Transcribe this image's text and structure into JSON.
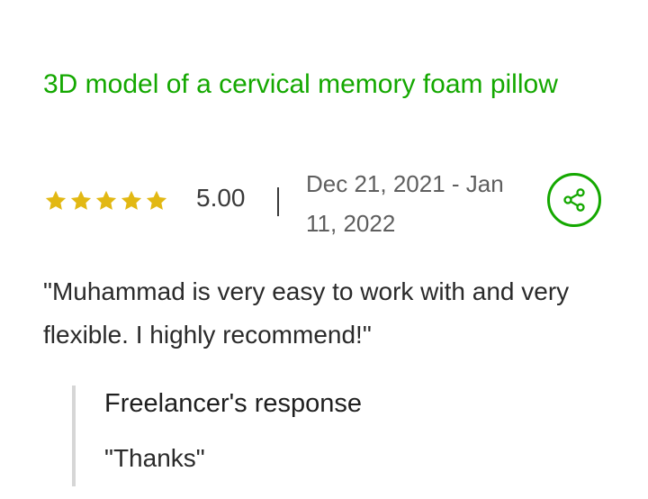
{
  "review": {
    "title": "3D model of a cervical memory foam pillow",
    "rating": 5.0,
    "rating_label": "5.00",
    "stars_total": 5,
    "star_color": "#e2b813",
    "separator": "|",
    "date_range": "Dec 21, 2021 - Jan 11, 2022",
    "feedback": "\"Muhammad is very easy to work with and very flexible. I highly recommend!\"",
    "share_icon": "share-icon"
  },
  "response": {
    "heading": "Freelancer's response",
    "text": "\"Thanks\""
  },
  "colors": {
    "accent": "#14a800",
    "star": "#e2b813",
    "border": "#d6d6d6"
  }
}
